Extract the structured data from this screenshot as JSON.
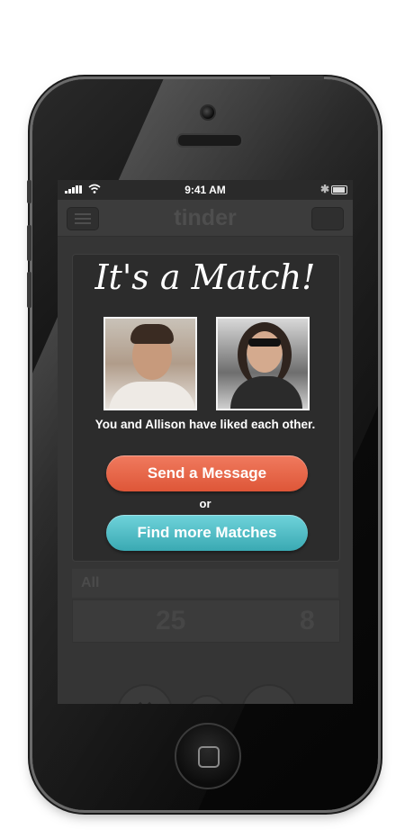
{
  "status_bar": {
    "time": "9:41 AM",
    "icons": [
      "signal-icon",
      "wifi-icon",
      "bluetooth-icon",
      "battery-icon"
    ]
  },
  "app_header": {
    "logo": "tinder",
    "icons": [
      "menu-icon",
      "chat-icon"
    ]
  },
  "background_card": {
    "name_fragment": "All",
    "stats": [
      "25",
      "8"
    ]
  },
  "match": {
    "title": "It's a Match!",
    "subtitle": "You and Allison have liked each other.",
    "primary_button": "Send a Message",
    "separator": "or",
    "secondary_button": "Find more Matches"
  },
  "bottom_actions": {
    "icons": [
      "dislike-x-icon",
      "info-icon",
      "like-heart-icon"
    ]
  },
  "colors": {
    "send_button": "#e2603f",
    "find_button": "#4ab8c1",
    "overlay": "#353535"
  }
}
